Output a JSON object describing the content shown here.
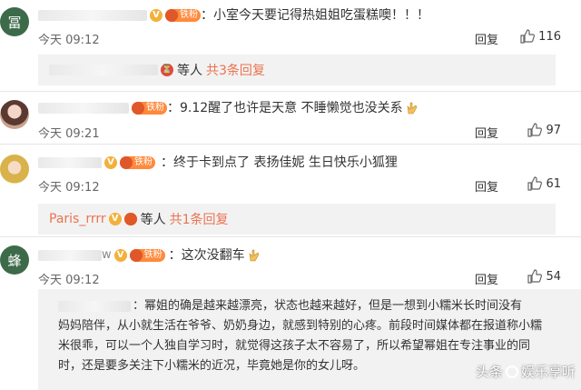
{
  "comments": [
    {
      "avatar_glyph": "冨",
      "badge": "铁粉",
      "text": "：小室今天要记得热姐姐吃蛋糕噢！！！",
      "time": "今天 09:12",
      "reply_label": "回复",
      "likes": "116",
      "replybox": {
        "suffix": "等人",
        "more": "共3条回复"
      }
    },
    {
      "badge": "铁粉",
      "text": "：9.12醒了也许是天意 不睡懒觉也没关系",
      "time": "今天 09:21",
      "reply_label": "回复",
      "likes": "97"
    },
    {
      "badge": "铁粉",
      "text": "：终于卡到点了 表扬佳妮 生日快乐小狐狸",
      "time": "今天 09:12",
      "reply_label": "回复",
      "likes": "61",
      "replybox": {
        "name": "Paris_rrrr",
        "suffix": "等人",
        "more": "共1条回复"
      }
    },
    {
      "avatar_glyph": "蜂",
      "name_tail": "w",
      "badge": "铁粉",
      "text": "：这次没翻车",
      "time": "今天 09:12",
      "reply_label": "回复",
      "likes": "54"
    }
  ],
  "long_reply": {
    "lines": [
      "：幂姐的确是越来越漂亮，状态也越来越好，但是一想到小糯米长时间没有",
      "妈妈陪伴，从小就生活在爷爷、奶奶身边，就感到特别的心疼。前段时间媒体都在报道称小糯",
      "米很乖，可以一个人独自学习时，就觉得这孩子太不容易了，所以希望幂姐在专注事业的同",
      "时，还是要多关注下小糯米的近况，毕竟她是你的女儿呀。"
    ]
  },
  "watermark": {
    "left": "头条",
    "right": "娱乐享听"
  },
  "colors": {
    "accent": "#eb7350",
    "badge": "#ff8a3c",
    "reply_bg": "#f2f2f2"
  }
}
